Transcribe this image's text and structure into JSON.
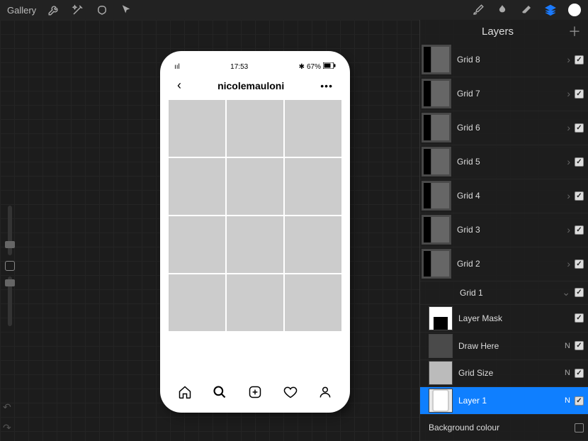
{
  "toolbar": {
    "gallery_label": "Gallery"
  },
  "layers_panel": {
    "title": "Layers",
    "groups": [
      {
        "label": "Grid 8"
      },
      {
        "label": "Grid 7"
      },
      {
        "label": "Grid 6"
      },
      {
        "label": "Grid 5"
      },
      {
        "label": "Grid 4"
      },
      {
        "label": "Grid 3"
      },
      {
        "label": "Grid 2"
      }
    ],
    "grid1": {
      "label": "Grid 1",
      "children": [
        {
          "label": "Layer Mask",
          "badge": ""
        },
        {
          "label": "Draw Here",
          "badge": "N"
        },
        {
          "label": "Grid Size",
          "badge": "N"
        },
        {
          "label": "Layer 1",
          "badge": "N"
        }
      ]
    },
    "background_label": "Background colour"
  },
  "phone": {
    "status": {
      "time": "17:53",
      "bluetooth": "✱",
      "battery_text": "67%",
      "signal": "ııl"
    },
    "header": {
      "title": "nicolemauloni",
      "more": "•••"
    }
  }
}
